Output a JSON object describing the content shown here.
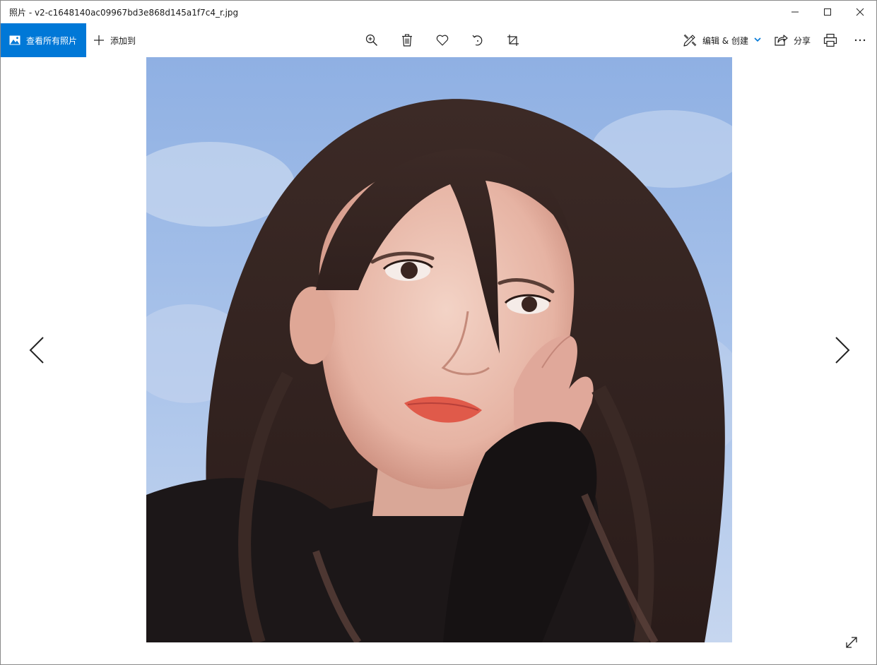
{
  "window": {
    "title": "照片 - v2-c1648140ac09967bd3e868d145a1f7c4_r.jpg"
  },
  "toolbar": {
    "view_all_label": "查看所有照片",
    "add_to_label": "添加到",
    "edit_create_label": "编辑 & 创建",
    "share_label": "分享",
    "accent_color": "#0078d7",
    "icons": {
      "view_all": "photo-icon",
      "add_to": "plus-icon",
      "zoom": "zoom-in-icon",
      "delete": "trash-icon",
      "favorite": "heart-icon",
      "rotate": "rotate-icon",
      "crop": "crop-icon",
      "edit": "edit-create-icon",
      "share": "share-icon",
      "print": "print-icon",
      "more": "more-icon"
    }
  },
  "viewer": {
    "photo_subject": "portrait photo",
    "nav": {
      "prev_icon": "chevron-left-icon",
      "next_icon": "chevron-right-icon"
    },
    "fullscreen_icon": "expand-icon"
  }
}
